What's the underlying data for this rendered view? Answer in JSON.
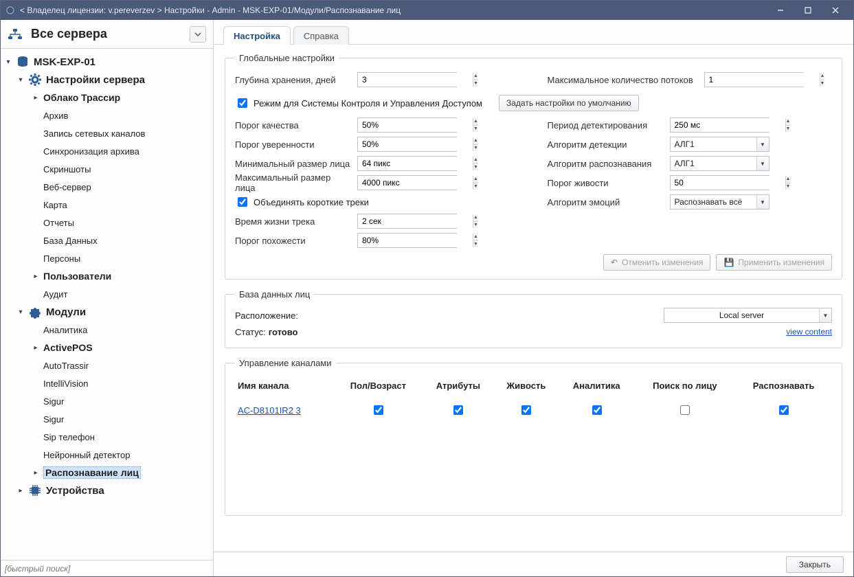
{
  "titlebar": "< Владелец лицензии: v.pereverzev > Настройки - Admin - MSK-EXP-01/Модули/Распознавание лиц",
  "sidebar": {
    "all_servers": "Все сервера",
    "nodes": [
      {
        "depth": 0,
        "caret": "down",
        "icon": "db",
        "label": "MSK-EXP-01",
        "bold": true
      },
      {
        "depth": 1,
        "caret": "down",
        "icon": "gear",
        "label": "Настройки сервера",
        "bold": true
      },
      {
        "depth": 2,
        "caret": "right",
        "icon": "",
        "label": "Облако Трассир",
        "bold2": true
      },
      {
        "depth": 2,
        "caret": "none",
        "icon": "",
        "label": "Архив"
      },
      {
        "depth": 2,
        "caret": "none",
        "icon": "",
        "label": "Запись сетевых каналов"
      },
      {
        "depth": 2,
        "caret": "none",
        "icon": "",
        "label": "Синхронизация архива"
      },
      {
        "depth": 2,
        "caret": "none",
        "icon": "",
        "label": "Скриншоты"
      },
      {
        "depth": 2,
        "caret": "none",
        "icon": "",
        "label": "Веб-сервер"
      },
      {
        "depth": 2,
        "caret": "none",
        "icon": "",
        "label": "Карта"
      },
      {
        "depth": 2,
        "caret": "none",
        "icon": "",
        "label": "Отчеты"
      },
      {
        "depth": 2,
        "caret": "none",
        "icon": "",
        "label": "База Данных"
      },
      {
        "depth": 2,
        "caret": "none",
        "icon": "",
        "label": "Персоны"
      },
      {
        "depth": 2,
        "caret": "right",
        "icon": "",
        "label": "Пользователи",
        "bold2": true
      },
      {
        "depth": 2,
        "caret": "none",
        "icon": "",
        "label": "Аудит"
      },
      {
        "depth": 1,
        "caret": "down",
        "icon": "puzzle",
        "label": "Модули",
        "bold": true
      },
      {
        "depth": 2,
        "caret": "none",
        "icon": "",
        "label": "Аналитика"
      },
      {
        "depth": 2,
        "caret": "right",
        "icon": "",
        "label": "ActivePOS",
        "bold2": true
      },
      {
        "depth": 2,
        "caret": "none",
        "icon": "",
        "label": "AutoTrassir"
      },
      {
        "depth": 2,
        "caret": "none",
        "icon": "",
        "label": "IntelliVision"
      },
      {
        "depth": 2,
        "caret": "none",
        "icon": "",
        "label": "Sigur"
      },
      {
        "depth": 2,
        "caret": "none",
        "icon": "",
        "label": "Sigur"
      },
      {
        "depth": 2,
        "caret": "none",
        "icon": "",
        "label": "Sip телефон"
      },
      {
        "depth": 2,
        "caret": "none",
        "icon": "",
        "label": "Нейронный детектор"
      },
      {
        "depth": 2,
        "caret": "right",
        "icon": "",
        "label": "Распознавание лиц",
        "bold2": true,
        "selected": true
      },
      {
        "depth": 1,
        "caret": "right",
        "icon": "chip",
        "label": "Устройства",
        "bold": true
      }
    ],
    "search_placeholder": "[быстрый поиск]"
  },
  "tabs": {
    "settings": "Настройка",
    "help": "Справка"
  },
  "global": {
    "legend": "Глобальные настройки",
    "storage_depth_label": "Глубина хранения, дней",
    "storage_depth": "3",
    "max_streams_label": "Максимальное количество потоков",
    "max_streams": "1",
    "acs_mode_label": "Режим для Системы Контроля и Управления Доступом",
    "defaults_btn": "Задать настройки по умолчанию",
    "quality_label": "Порог качества",
    "quality": "50%",
    "confidence_label": "Порог уверенности",
    "confidence": "50%",
    "min_face_label": "Минимальный размер лица",
    "min_face": "64 пикс",
    "max_face_label": "Максимальный размер лица",
    "max_face": "4000 пикс",
    "merge_tracks_label": "Объединять короткие треки",
    "track_life_label": "Время жизни трека",
    "track_life": "2 сек",
    "similarity_label": "Порог похожести",
    "similarity": "80%",
    "detect_period_label": "Период детектирования",
    "detect_period": "250 мс",
    "detect_algo_label": "Алгоритм детекции",
    "detect_algo": "АЛГ1",
    "recog_algo_label": "Алгоритм распознавания",
    "recog_algo": "АЛГ1",
    "liveness_th_label": "Порог живости",
    "liveness_th": "50",
    "emotion_algo_label": "Алгоритм эмоций",
    "emotion_algo": "Распознавать всё",
    "cancel_btn": "Отменить изменения",
    "apply_btn": "Применить изменения"
  },
  "facedb": {
    "legend": "База данных лиц",
    "location_label": "Расположение:",
    "location_value": "Local server",
    "status_label": "Статус:",
    "status_value": "готово",
    "view_link": "view content"
  },
  "channels": {
    "legend": "Управление каналами",
    "headers": [
      "Имя канала",
      "Пол/Возраст",
      "Атрибуты",
      "Живость",
      "Аналитика",
      "Поиск по лицу",
      "Распознавать"
    ],
    "rows": [
      {
        "name": "AC-D8101IR2 3",
        "gender": true,
        "attr": true,
        "live": true,
        "analytics": true,
        "search": false,
        "recognize": true
      }
    ]
  },
  "footer": {
    "close": "Закрыть"
  }
}
